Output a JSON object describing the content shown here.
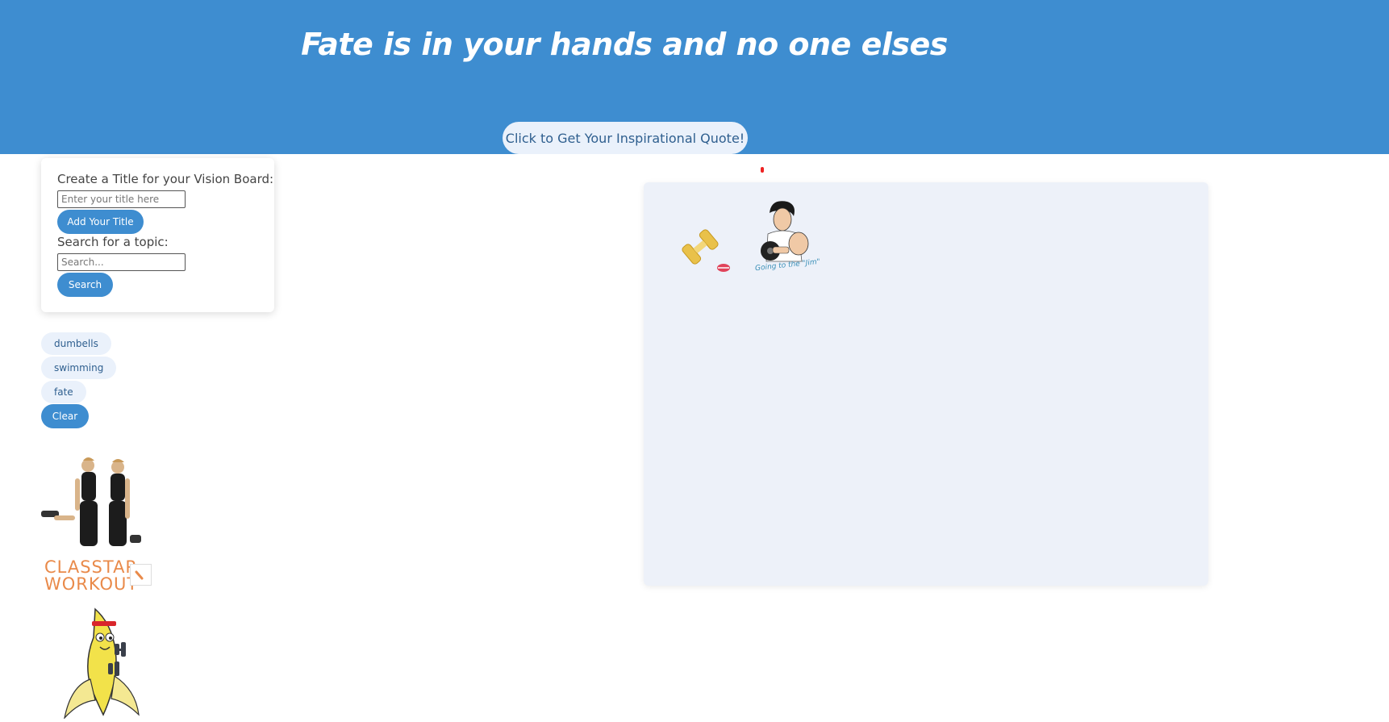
{
  "header": {
    "quote": "Fate is in your hands and no one elses",
    "quote_button_label": "Click to Get Your Inspirational Quote!"
  },
  "panel": {
    "title_label": "Create a Title for your Vision Board:",
    "title_placeholder": "Enter your title here",
    "title_value": "",
    "add_title_label": "Add Your Title",
    "search_label": "Search for a topic:",
    "search_placeholder": "Search...",
    "search_value": "",
    "search_button_label": "Search"
  },
  "search_history": {
    "items": [
      "dumbells",
      "swimming",
      "fate"
    ],
    "clear_label": "Clear"
  },
  "results": {
    "workout_text_line1": "CLASSTAP",
    "workout_text_line2": "WORKOUT"
  },
  "board": {
    "sticker_caption": "Going to the \"Jim\""
  },
  "colors": {
    "header": "#3e8dd0",
    "button": "#3e8dd0",
    "tag": "#eaf1fb",
    "board": "#edf1f9"
  }
}
